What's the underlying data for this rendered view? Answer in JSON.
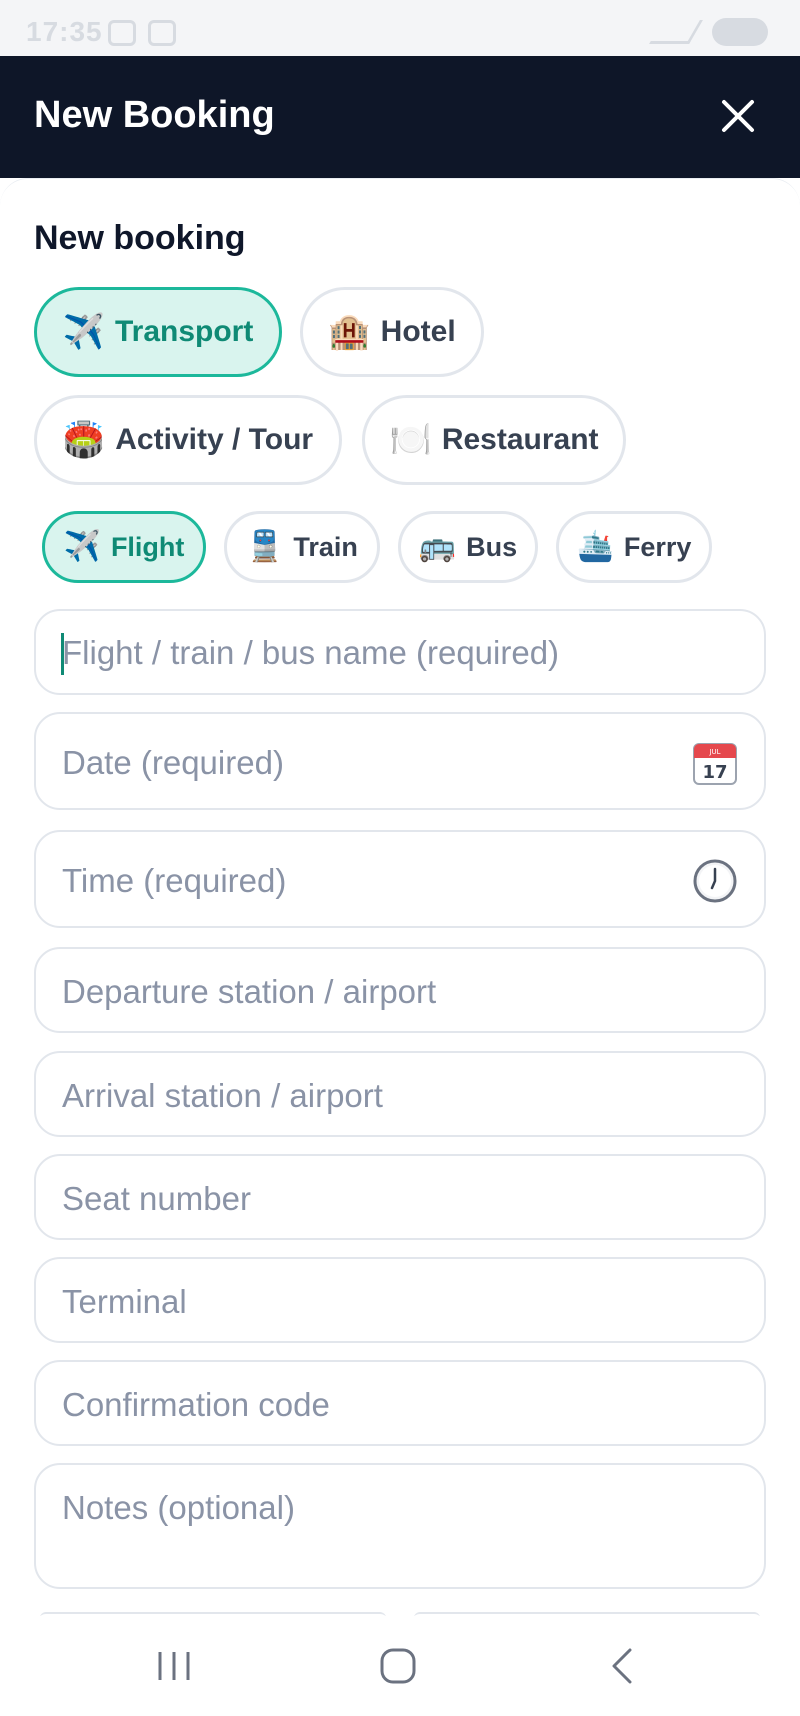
{
  "status_bar": {
    "time": "17:35"
  },
  "header": {
    "title": "New Booking"
  },
  "sheet": {
    "title": "New booking"
  },
  "categories": [
    {
      "label": "Transport",
      "emoji": "✈️",
      "active": true
    },
    {
      "label": "Hotel",
      "emoji": "🏨",
      "active": false
    },
    {
      "label": "Activity / Tour",
      "emoji": "🏟️",
      "active": false
    },
    {
      "label": "Restaurant",
      "emoji": "🍽️",
      "active": false
    }
  ],
  "transport_types": [
    {
      "label": "Flight",
      "emoji": "✈️",
      "active": true
    },
    {
      "label": "Train",
      "emoji": "🚆",
      "active": false
    },
    {
      "label": "Bus",
      "emoji": "🚌",
      "active": false
    },
    {
      "label": "Ferry",
      "emoji": "🛳️",
      "active": false
    }
  ],
  "fields": {
    "name": {
      "placeholder": "Flight / train / bus name (required)",
      "value": ""
    },
    "date": {
      "placeholder": "Date (required)",
      "icon": "calendar-icon",
      "value": ""
    },
    "time": {
      "placeholder": "Time (required)",
      "icon": "clock-icon",
      "value": ""
    },
    "departure": {
      "placeholder": "Departure station / airport",
      "value": ""
    },
    "arrival": {
      "placeholder": "Arrival station / airport",
      "value": ""
    },
    "seat": {
      "placeholder": "Seat number",
      "value": ""
    },
    "terminal": {
      "placeholder": "Terminal",
      "value": ""
    },
    "confirmation": {
      "placeholder": "Confirmation code",
      "value": ""
    },
    "notes": {
      "placeholder": "Notes (optional)",
      "value": ""
    }
  },
  "calendar_icon": {
    "month": "JUL",
    "day": "17"
  },
  "colors": {
    "header_bg": "#0e1628",
    "accent": "#1cb89b",
    "accent_bg": "#d9f4ee",
    "placeholder": "#8a93a6"
  }
}
